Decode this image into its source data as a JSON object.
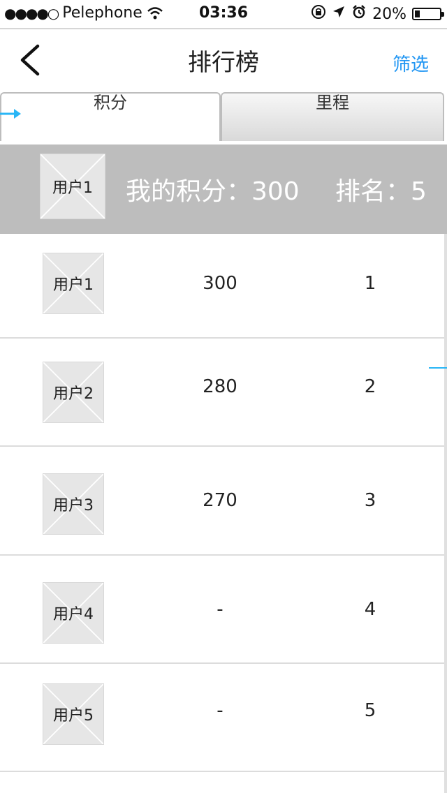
{
  "status_bar": {
    "signal": "●●●●○",
    "carrier": "Pelephone",
    "time": "03:36",
    "icons": [
      "wifi-icon",
      "rotation-lock-icon",
      "location-arrow-icon",
      "alarm-icon"
    ],
    "battery_text": "20%",
    "battery_level": 0.2
  },
  "nav": {
    "title": "排行榜",
    "filter_label": "筛选",
    "accent_color": "#2196f3"
  },
  "tabs": [
    {
      "label": "积分",
      "active": true
    },
    {
      "label": "里程",
      "active": false
    }
  ],
  "my": {
    "avatar_label": "用户1",
    "score_text": "我的积分：300",
    "rank_text": "排名：5"
  },
  "ranking": [
    {
      "user": "用户1",
      "score": "300",
      "rank": "1"
    },
    {
      "user": "用户2",
      "score": "280",
      "rank": "2"
    },
    {
      "user": "用户3",
      "score": "270",
      "rank": "3"
    },
    {
      "user": "用户4",
      "score": "-",
      "rank": "4"
    },
    {
      "user": "用户5",
      "score": "-",
      "rank": "5"
    }
  ]
}
